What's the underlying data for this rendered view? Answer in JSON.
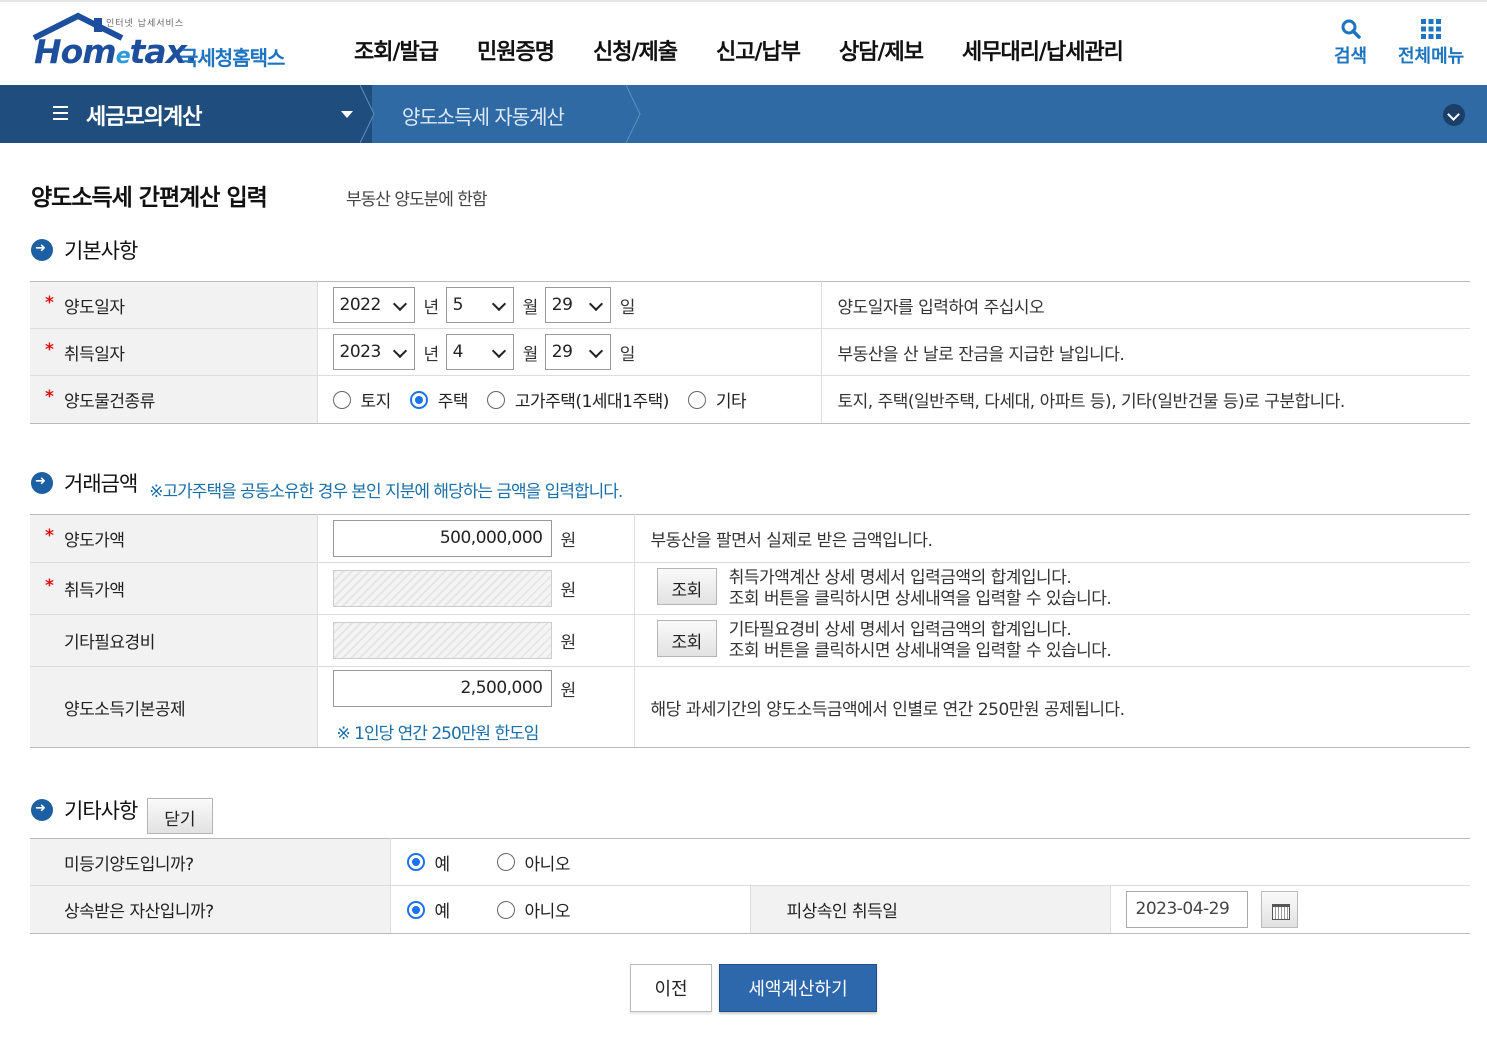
{
  "header": {
    "logo_tagline": "인터넷 납세서비스",
    "logo_word_a": "Hom",
    "logo_word_e": "e",
    "logo_word_b": "tax.",
    "logo_korean": "국세청홈택스",
    "nav": [
      "조회/발급",
      "민원증명",
      "신청/제출",
      "신고/납부",
      "상담/제보",
      "세무대리/납세관리"
    ],
    "search_label": "검색",
    "allmenu_label": "전체메뉴"
  },
  "breadcrumb": {
    "menu": "세금모의계산",
    "current": "양도소득세 자동계산"
  },
  "page": {
    "title": "양도소득세 간편계산 입력",
    "subtitle": "부동산 양도분에 한함"
  },
  "basic": {
    "section_title": "기본사항",
    "req_mark": "*",
    "transfer_date": {
      "label": "양도일자",
      "year": "2022",
      "month": "5",
      "day": "29",
      "desc": "양도일자를 입력하여 주십시오"
    },
    "acquire_date": {
      "label": "취득일자",
      "year": "2023",
      "month": "4",
      "day": "29",
      "desc": "부동산을 산 날로 잔금을 지급한 날입니다."
    },
    "units": {
      "year": "년",
      "month": "월",
      "day": "일"
    },
    "property_type": {
      "label": "양도물건종류",
      "options": [
        "토지",
        "주택",
        "고가주택(1세대1주택)",
        "기타"
      ],
      "selected": "주택",
      "desc": "토지, 주택(일반주택, 다세대, 아파트 등), 기타(일반건물 등)로 구분합니다."
    }
  },
  "amount": {
    "section_title": "거래금액",
    "note": "※고가주택을 공동소유한 경우 본인 지분에 해당하는 금액을 입력합니다.",
    "won": "원",
    "transfer_price": {
      "label": "양도가액",
      "value": "500,000,000",
      "desc": "부동산을 팔면서 실제로 받은 금액입니다."
    },
    "acquire_price": {
      "label": "취득가액",
      "value": "",
      "button": "조회",
      "desc1": "취득가액계산 상세 명세서 입력금액의 합계입니다.",
      "desc2": "조회 버튼을 클릭하시면 상세내역을 입력할 수 있습니다."
    },
    "other_expense": {
      "label": "기타필요경비",
      "value": "",
      "button": "조회",
      "desc1": "기타필요경비 상세 명세서 입력금액의 합계입니다.",
      "desc2": "조회 버튼을 클릭하시면 상세내역을 입력할 수 있습니다."
    },
    "basic_deduction": {
      "label": "양도소득기본공제",
      "value": "2,500,000",
      "hint": "※ 1인당 연간 250만원 한도임",
      "desc": "해당 과세기간의 양도소득금액에서 인별로 연간 250만원 공제됩니다."
    }
  },
  "etc": {
    "section_title": "기타사항",
    "close_button": "닫기",
    "unregistered": {
      "label": "미등기양도입니까?",
      "yes": "예",
      "no": "아니오",
      "selected": "예"
    },
    "inherited": {
      "label": "상속받은 자산입니까?",
      "yes": "예",
      "no": "아니오",
      "selected": "예",
      "date_label": "피상속인 취득일",
      "date_value": "2023-04-29"
    }
  },
  "actions": {
    "prev": "이전",
    "calc": "세액계산하기"
  },
  "colors": {
    "brand_blue": "#1d4f9e",
    "bar_dark": "#1f4e7e",
    "bar_light": "#2f6aa5",
    "button_primary": "#2d68ad",
    "required_red": "#dd1111"
  }
}
